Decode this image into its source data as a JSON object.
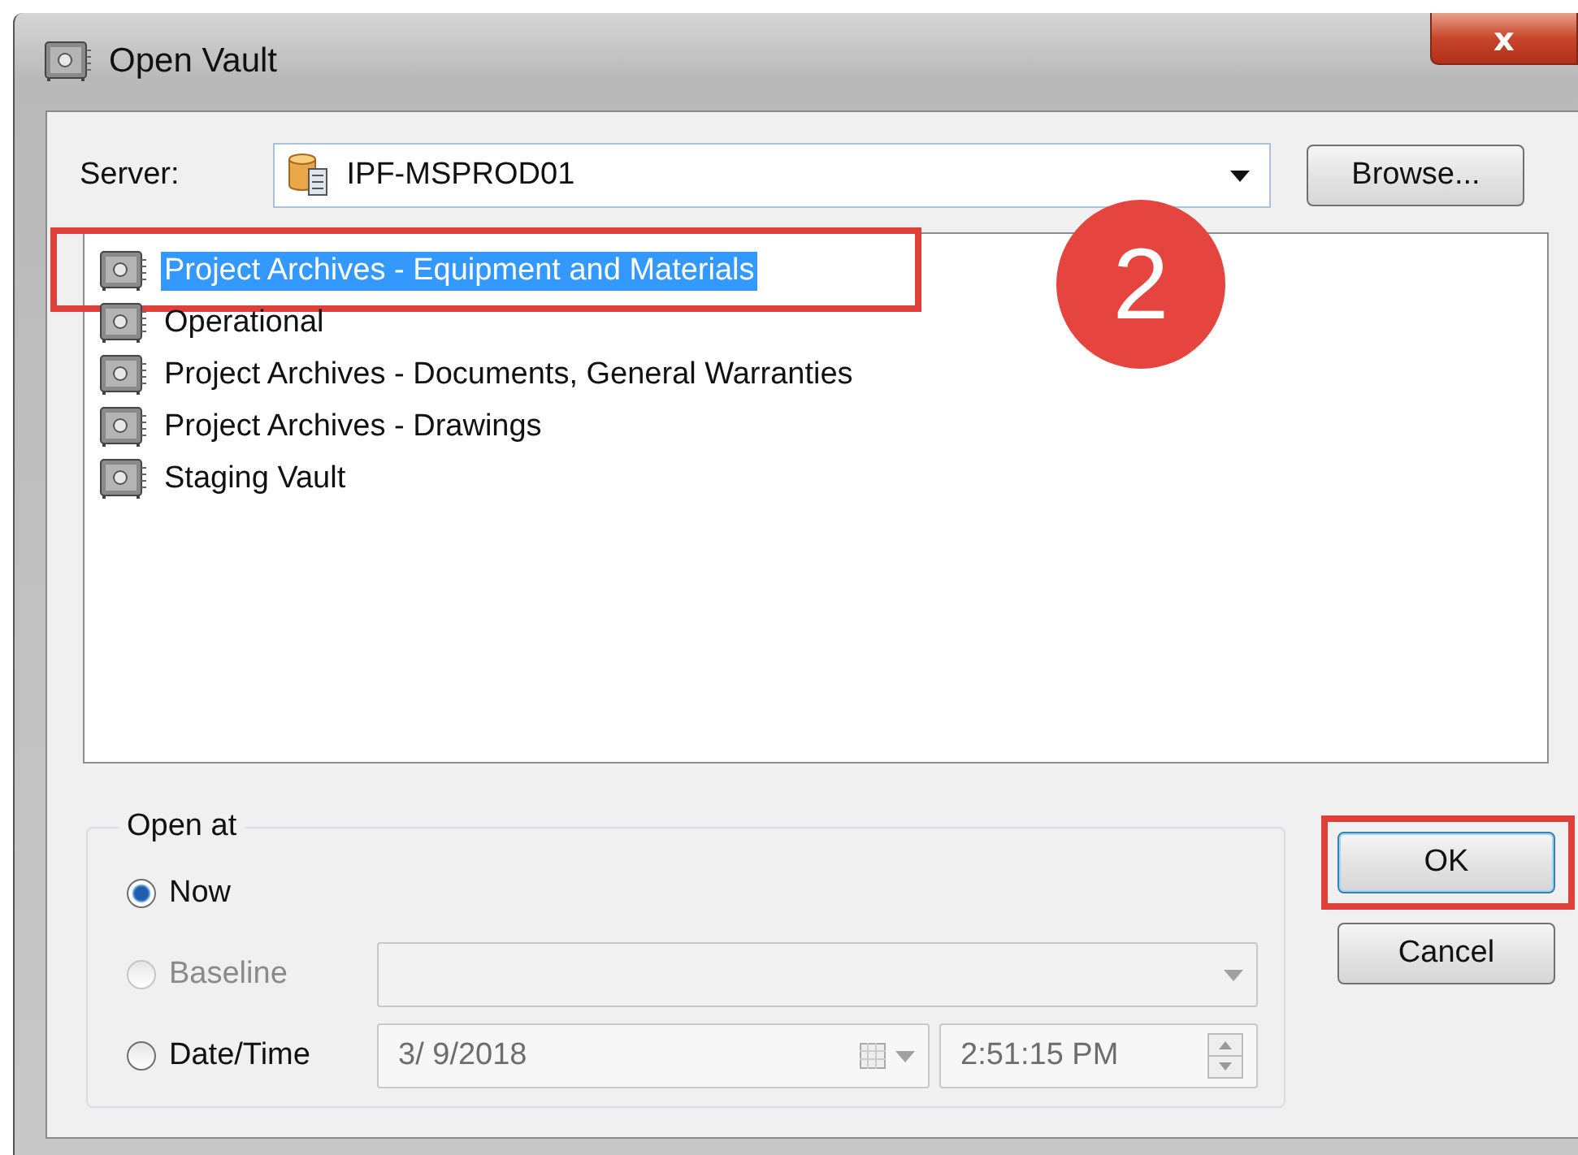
{
  "window": {
    "title": "Open Vault",
    "close": "x"
  },
  "server": {
    "label": "Server:",
    "value": "IPF-MSPROD01",
    "browse": "Browse..."
  },
  "vaults": [
    {
      "name": "Project Archives - Equipment and Materials",
      "selected": true,
      "highlighted": true
    },
    {
      "name": "Operational",
      "selected": false,
      "highlighted": false
    },
    {
      "name": "Project Archives - Documents, General Warranties",
      "selected": false,
      "highlighted": false
    },
    {
      "name": "Project Archives - Drawings",
      "selected": false,
      "highlighted": false
    },
    {
      "name": "Staging Vault",
      "selected": false,
      "highlighted": false
    }
  ],
  "callout": {
    "text": "2"
  },
  "open_at": {
    "title": "Open at",
    "options": [
      {
        "kind": "plain",
        "label": "Now",
        "selected": true,
        "disabled": false
      },
      {
        "kind": "dropdown",
        "label": "Baseline",
        "selected": false,
        "disabled": true
      },
      {
        "kind": "datetime",
        "label": "Date/Time",
        "selected": false,
        "disabled": false,
        "date": "3/  9/2018",
        "time": "2:51:15 PM"
      }
    ]
  },
  "buttons": [
    {
      "label": "OK",
      "default": true,
      "highlighted": true
    },
    {
      "label": "Cancel",
      "default": false,
      "highlighted": false
    }
  ]
}
